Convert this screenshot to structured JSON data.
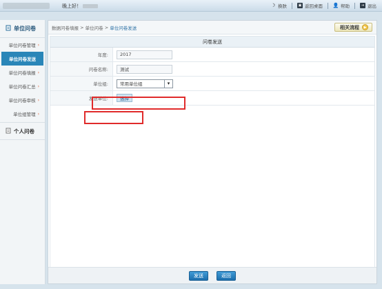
{
  "header": {
    "greeting": "晚上好！",
    "links": [
      {
        "icon": "moon-icon",
        "label": "换肤"
      },
      {
        "icon": "desktop-icon",
        "label": "返回桌面"
      },
      {
        "icon": "person-icon",
        "label": "帮助"
      },
      {
        "icon": "exit-icon",
        "label": "退出"
      }
    ]
  },
  "sidebar": {
    "title": "单位问卷",
    "items": [
      {
        "label": "单位问卷管理",
        "active": false
      },
      {
        "label": "单位问卷发送",
        "active": true
      },
      {
        "label": "单位问卷填报",
        "active": false
      },
      {
        "label": "单位问卷汇总",
        "active": false
      },
      {
        "label": "单位问卷审核",
        "active": false
      },
      {
        "label": "单位组管理",
        "active": false
      }
    ],
    "group2": "个人问卷"
  },
  "breadcrumb": {
    "part1": "数据问卷填报",
    "sep": ">",
    "part2": "单位问卷",
    "current": "单位问卷发送"
  },
  "flow_button": "相关流程",
  "form": {
    "title": "问卷发送",
    "year_label": "年度:",
    "year_value": "2017",
    "name_label": "问卷名称:",
    "name_value": "测试",
    "group_label": "单位组:",
    "group_selected": "常用单位组",
    "send_label": "发送单位:",
    "choose_button": "选择"
  },
  "footer": {
    "send_button": "发送",
    "back_button": "返回"
  },
  "colors": {
    "accent": "#2a86b8",
    "highlight": "#e02a2a"
  }
}
